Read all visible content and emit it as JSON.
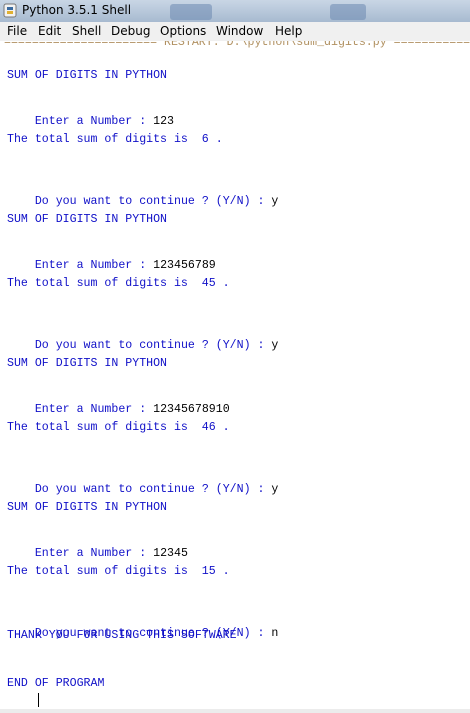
{
  "window": {
    "title": "Python 3.5.1 Shell"
  },
  "menu": [
    "File",
    "Edit",
    "Shell",
    "Debug",
    "Options",
    "Window",
    "Help"
  ],
  "shell": {
    "restart_line": "====================== RESTART: D:\\python\\sum_digits.py ======================",
    "runs": [
      {
        "heading": "SUM OF DIGITS IN PYTHON",
        "prompt": "Enter a Number : ",
        "input": "123",
        "result": "The total sum of digits is  6 .",
        "continue_prompt": "Do you want to continue ? (Y/N) : ",
        "answer": "y"
      },
      {
        "heading": "SUM OF DIGITS IN PYTHON",
        "prompt": "Enter a Number : ",
        "input": "123456789",
        "result": "The total sum of digits is  45 .",
        "continue_prompt": "Do you want to continue ? (Y/N) : ",
        "answer": "y"
      },
      {
        "heading": "SUM OF DIGITS IN PYTHON",
        "prompt": "Enter a Number : ",
        "input": "12345678910",
        "result": "The total sum of digits is  46 .",
        "continue_prompt": "Do you want to continue ? (Y/N) : ",
        "answer": "y"
      },
      {
        "heading": "SUM OF DIGITS IN PYTHON",
        "prompt": "Enter a Number : ",
        "input": "12345",
        "result": "The total sum of digits is  15 .",
        "continue_prompt": "Do you want to continue ? (Y/N) : ",
        "answer": "n"
      }
    ],
    "thank_you": "THANK YOU FOR USING THIS SOFTWARE",
    "end": "END OF PROGRAM",
    "repl_prompt": ">>> "
  },
  "colors": {
    "output": "#1010c8",
    "input": "#000000",
    "prompt": "#8b2020",
    "restart": "#b09060"
  }
}
